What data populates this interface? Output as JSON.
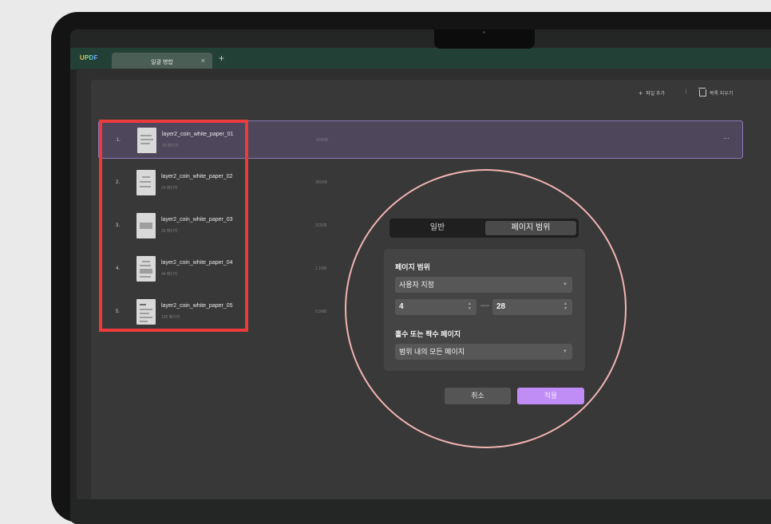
{
  "app": {
    "logo": "UPDF"
  },
  "tabs": [
    {
      "label": "일괄 병합",
      "close": "×"
    }
  ],
  "tab_add": "+",
  "toolbar": {
    "add_file_label": "파일 추가",
    "separator": "|",
    "clear_list_label": "목록 지우기"
  },
  "files": [
    {
      "index": "1.",
      "name": "layer2_coin_white_paper_01",
      "pages": "30 페이지",
      "size": "829KB",
      "more": "···"
    },
    {
      "index": "2.",
      "name": "layer2_coin_white_paper_02",
      "pages": "24 페이지",
      "size": "391KB"
    },
    {
      "index": "3.",
      "name": "layer2_coin_white_paper_03",
      "pages": "26 페이지",
      "size": "311KB"
    },
    {
      "index": "4.",
      "name": "layer2_coin_white_paper_04",
      "pages": "44 페이지",
      "size": "1.1MB"
    },
    {
      "index": "5.",
      "name": "layer2_coin_white_paper_05",
      "pages": "130 페이지",
      "size": "5.5MB"
    }
  ],
  "dialog": {
    "tabs": {
      "general": "일반",
      "page_range": "페이지 범위",
      "active": "page_range"
    },
    "page_range_label": "페이지 범위",
    "page_range_select": "사용자 지정",
    "range_from": "4",
    "range_dash": "—",
    "range_to": "28",
    "odd_even_label": "홀수 또는 짝수 페이지",
    "odd_even_select": "범위 내의 모든 페이지",
    "cancel_label": "취소",
    "apply_label": "적용"
  },
  "colors": {
    "highlight_box": "#ec3b3b",
    "zoom_circle": "#f3b3b3",
    "apply_button": "#c08cf6",
    "selected_row": "#4e465b"
  }
}
